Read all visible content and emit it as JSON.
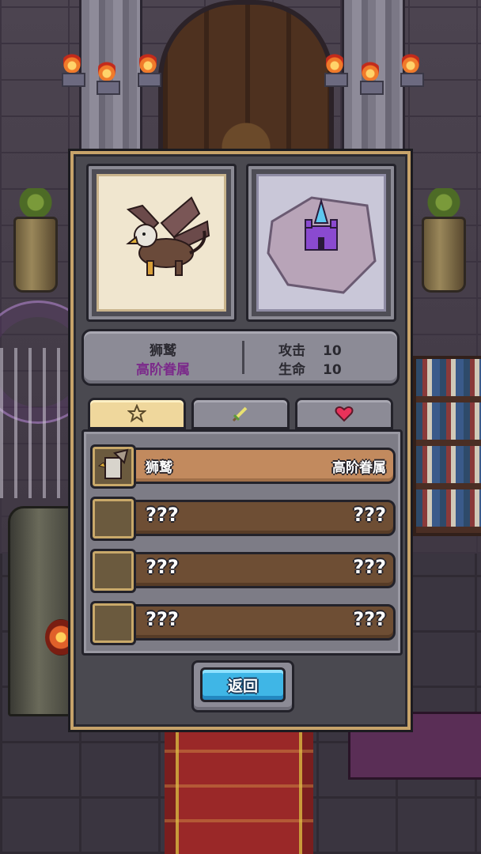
{
  "creature": {
    "name": "狮鹫",
    "rank": "高阶眷属",
    "stats": [
      {
        "label": "攻击",
        "value": "10"
      },
      {
        "label": "生命",
        "value": "10"
      }
    ]
  },
  "tabs": [
    {
      "icon": "star-icon",
      "active": true
    },
    {
      "icon": "sword-icon",
      "active": false
    },
    {
      "icon": "heart-icon",
      "active": false
    }
  ],
  "list": [
    {
      "name": "狮鹫",
      "rank": "高阶眷属",
      "unlocked": true
    },
    {
      "name": "???",
      "rank": "???",
      "unlocked": false
    },
    {
      "name": "???",
      "rank": "???",
      "unlocked": false
    },
    {
      "name": "???",
      "rank": "???",
      "unlocked": false
    }
  ],
  "back_button": {
    "label": "返回"
  },
  "colors": {
    "rank_text": "#7b2a8a",
    "active_tab": "#efd79c",
    "unlocked_row": "#c28a5e",
    "locked_row": "#6e4e34",
    "back_button": "#3fb6e6"
  }
}
